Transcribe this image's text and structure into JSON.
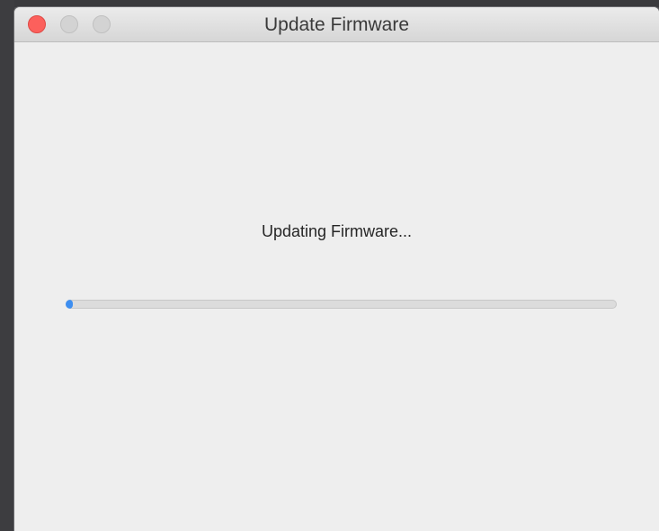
{
  "window": {
    "title": "Update Firmware",
    "controls": {
      "close": "close",
      "minimize": "minimize",
      "zoom": "zoom"
    }
  },
  "content": {
    "status_text": "Updating Firmware...",
    "progress": {
      "fraction": 0.01,
      "color": "#3d8ef0"
    }
  }
}
